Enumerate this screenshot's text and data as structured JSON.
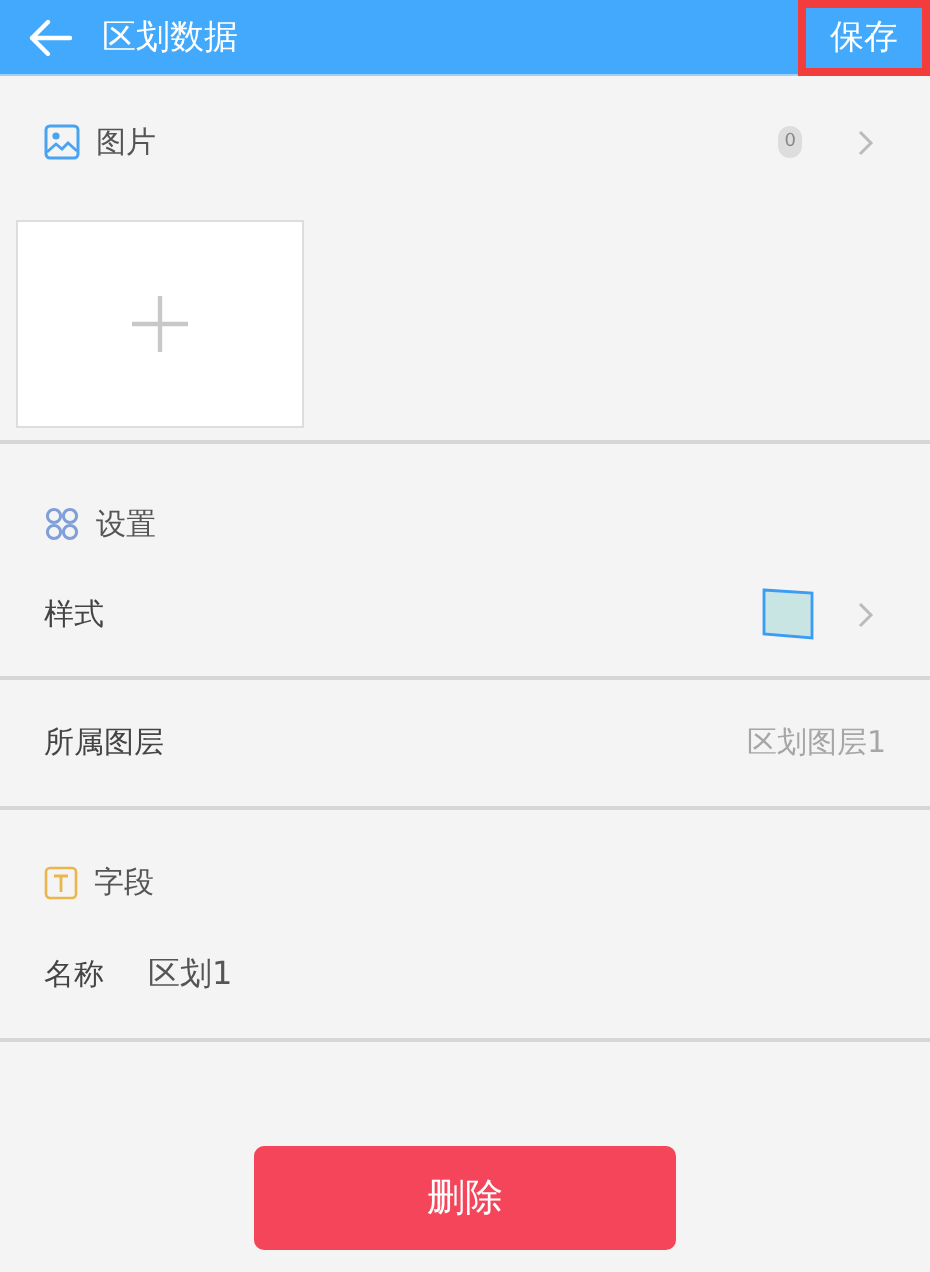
{
  "header": {
    "title": "区划数据",
    "save": "保存",
    "save_highlighted": true
  },
  "photos": {
    "label": "图片",
    "count": "0"
  },
  "settings": {
    "heading": "设置",
    "style_label": "样式"
  },
  "layer": {
    "label": "所属图层",
    "value": "区划图层1"
  },
  "fields": {
    "heading": "字段",
    "items": [
      {
        "label": "名称",
        "value": "区划1"
      }
    ]
  },
  "delete": "删除"
}
